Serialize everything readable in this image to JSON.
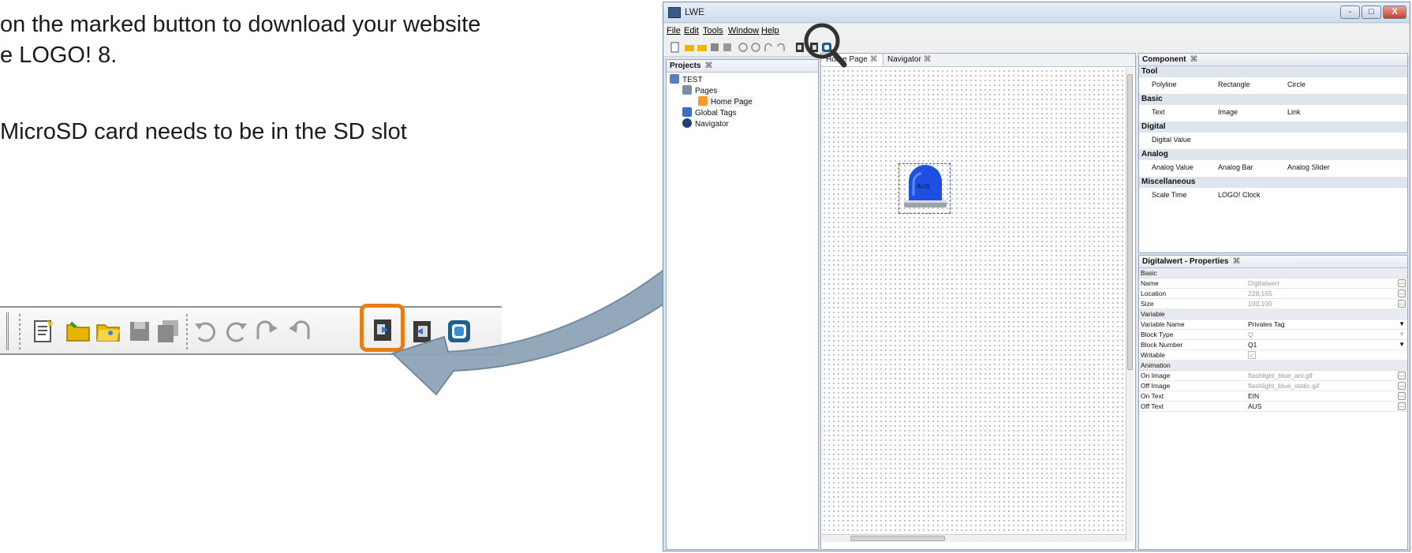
{
  "instructions": {
    "line1": "on the marked button to download your website",
    "line2": "e LOGO! 8.",
    "line3": "MicroSD card needs to be in the SD slot"
  },
  "zoom_toolbar": {
    "icons": [
      "new-icon",
      "open-folder-icon",
      "open-project-icon",
      "save-icon",
      "save-all-icon",
      "undo-icon",
      "redo-icon",
      "forward-icon",
      "back-icon",
      "download-to-logo-icon",
      "upload-icon",
      "connect-icon"
    ],
    "highlighted_icon": "download-to-logo-icon",
    "highlight_color": "#e87c16"
  },
  "window": {
    "title": "LWE",
    "controls": [
      "-",
      "□",
      "X"
    ],
    "menu": [
      "File",
      "Edit",
      "Tools",
      "Window",
      "Help"
    ],
    "projects_panel": {
      "title": "Projects",
      "tree": [
        "TEST",
        "Pages",
        "Home Page",
        "Global Tags",
        "Navigator"
      ]
    },
    "editor_tabs": [
      "Home Page",
      "Navigator"
    ],
    "component_panel": {
      "title": "Component",
      "sections": [
        {
          "name": "Tool",
          "items": [
            "Polyline",
            "Rectangle",
            "Circle"
          ]
        },
        {
          "name": "Basic",
          "items": [
            "Text",
            "Image",
            "Link"
          ]
        },
        {
          "name": "Digital",
          "items": [
            "Digital Value"
          ]
        },
        {
          "name": "Analog",
          "items": [
            "Analog Value",
            "Analog Bar",
            "Analog Slider"
          ]
        },
        {
          "name": "Miscellaneous",
          "items": [
            "Scale Time",
            "LOGO! Clock"
          ]
        }
      ]
    },
    "properties_panel": {
      "title": "Digitalwert - Properties",
      "sections": [
        {
          "name": "Basic",
          "rows": [
            [
              "Name",
              "Digitalwert"
            ],
            [
              "Location",
              "228,165"
            ],
            [
              "Size",
              "100,100"
            ]
          ]
        },
        {
          "name": "Variable",
          "rows": [
            [
              "Variable Name",
              "Privates Tag"
            ],
            [
              "Block Type",
              "Q"
            ],
            [
              "Block Number",
              "Q1"
            ],
            [
              "Writable",
              "✓"
            ]
          ]
        },
        {
          "name": "Animation",
          "rows": [
            [
              "On Image",
              "flashlight_blue_ani.gif"
            ],
            [
              "Off Image",
              "flashlight_blue_static.gif"
            ],
            [
              "On Text",
              "EIN"
            ],
            [
              "Off Text",
              "AUS"
            ]
          ]
        }
      ]
    },
    "canvas_object": {
      "label": "AUS",
      "color": "#1f4fe0"
    },
    "accent_color": "#1e4e9c"
  }
}
